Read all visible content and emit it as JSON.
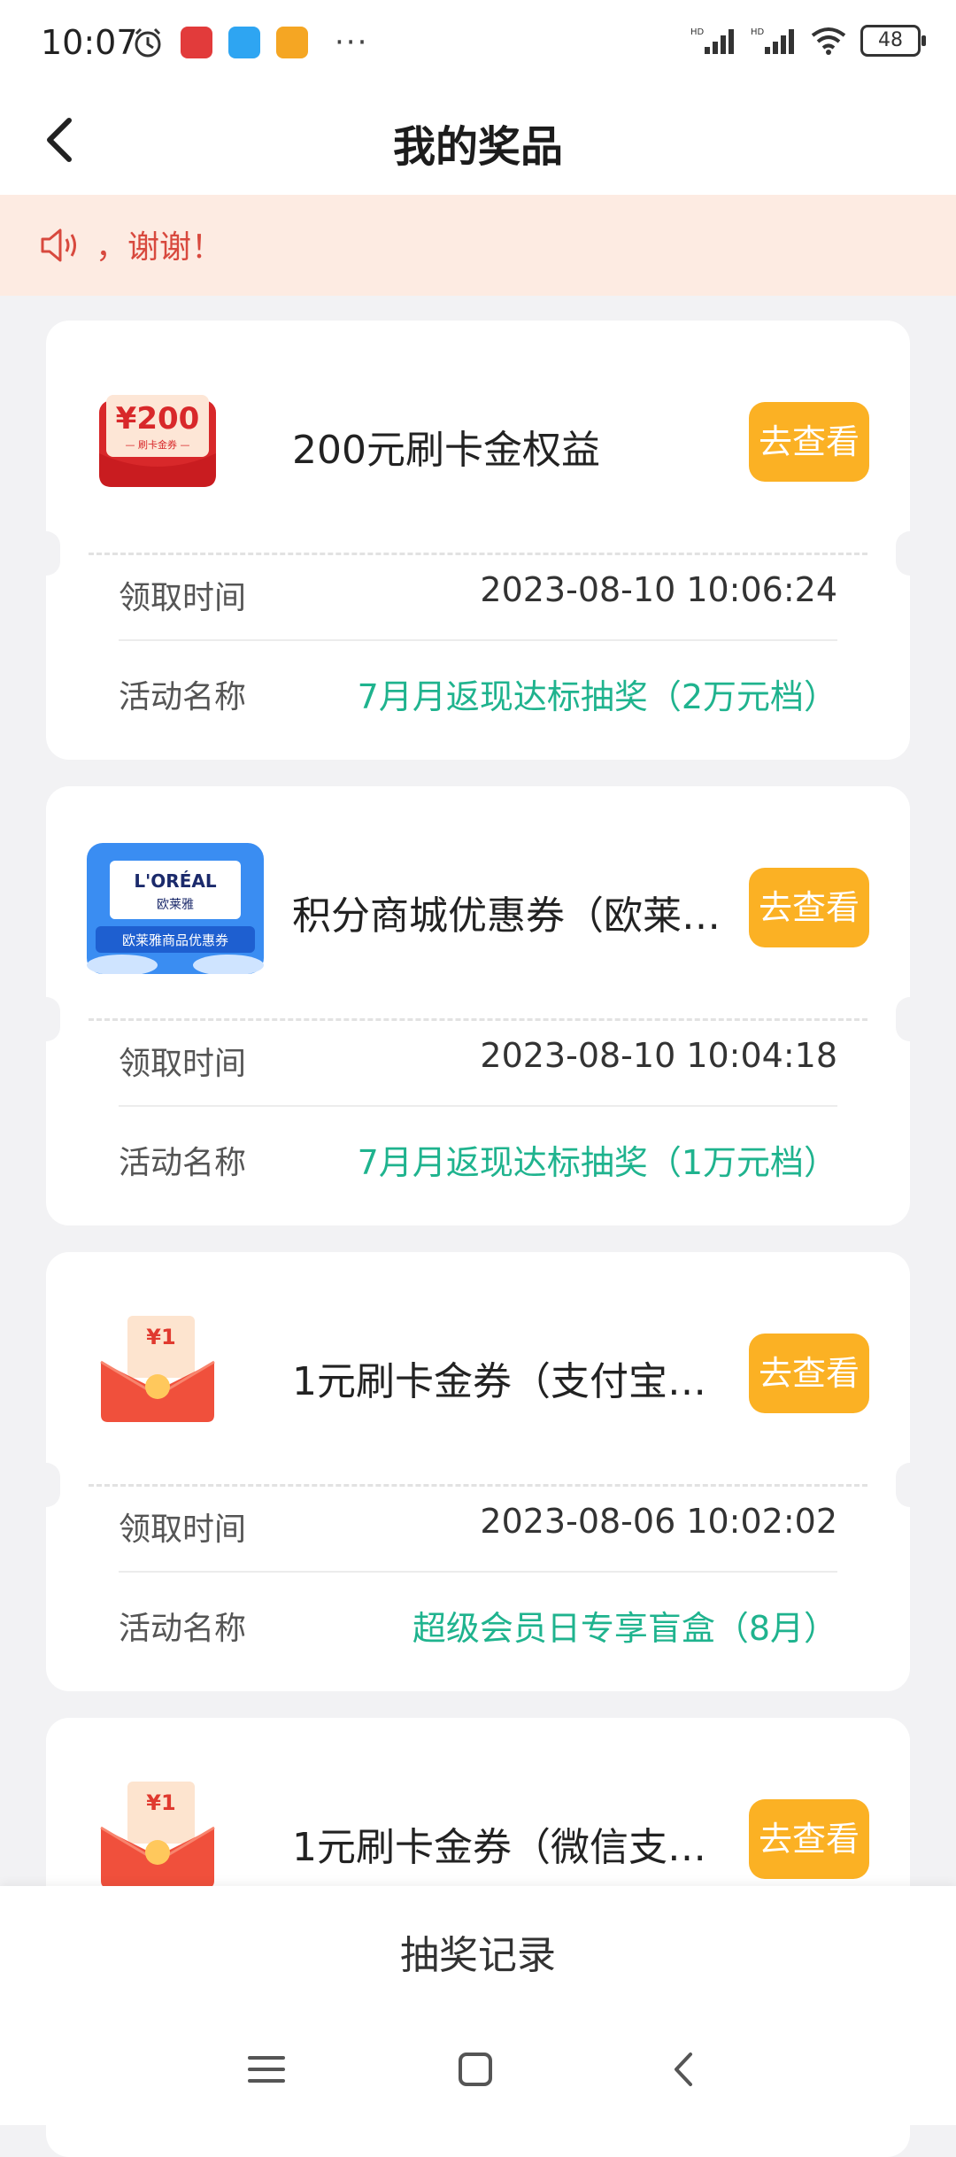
{
  "status_bar": {
    "time": "10:07",
    "battery": "48",
    "icons": [
      "alarm-icon",
      "app-icon-red",
      "app-icon-blue",
      "app-icon-orange",
      "more-dots",
      "hd-signal-icon",
      "hd-signal-icon",
      "wifi-icon",
      "battery-icon"
    ],
    "more": "···"
  },
  "header": {
    "title": "我的奖品"
  },
  "notice": {
    "text": "，谢谢！"
  },
  "prizes": [
    {
      "title": "200元刷卡金权益",
      "button": "去查看",
      "time_label": "领取时间",
      "time_value": "2023-08-10 10:06:24",
      "activity_label": "活动名称",
      "activity_value": "7月月返现达标抽奖（2万元档）",
      "image_text": "¥200",
      "image_sub": "— 刷卡金券 —"
    },
    {
      "title": "积分商城优惠券（欧莱…",
      "button": "去查看",
      "time_label": "领取时间",
      "time_value": "2023-08-10 10:04:18",
      "activity_label": "活动名称",
      "activity_value": "7月月返现达标抽奖（1万元档）",
      "image_text": "L'ORÉAL",
      "image_text2": "欧莱雅",
      "image_sub": "欧莱雅商品优惠券"
    },
    {
      "title": "1元刷卡金券（支付宝…",
      "button": "去查看",
      "time_label": "领取时间",
      "time_value": "2023-08-06 10:02:02",
      "activity_label": "活动名称",
      "activity_value": "超级会员日专享盲盒（8月）",
      "image_text": "¥1"
    },
    {
      "title": "1元刷卡金券（微信支…",
      "button": "去查看",
      "image_text": "¥1"
    }
  ],
  "bottom": {
    "label": "抽奖记录"
  },
  "colors": {
    "accent_button": "#fbb124",
    "activity_green": "#1fb38e",
    "notice_red": "#d8493e"
  }
}
